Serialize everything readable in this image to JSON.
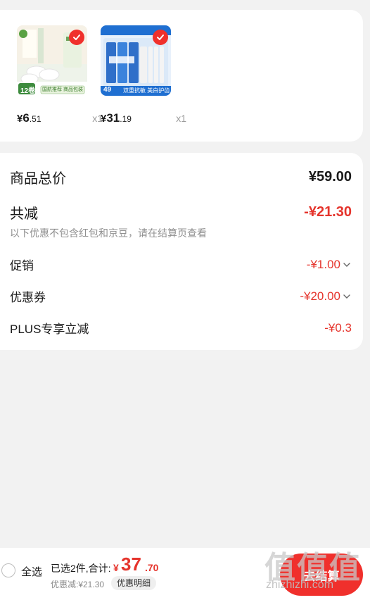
{
  "products": [
    {
      "image_text": "12卷",
      "image_banner": "国航推荐 商品包装",
      "price_symbol": "¥",
      "price_int": "6",
      "price_dec": ".51",
      "quantity": "x1"
    },
    {
      "image_text": "49",
      "image_banner": "双重抗敏 美白护齿",
      "price_symbol": "¥",
      "price_int": "31",
      "price_dec": ".19",
      "quantity": "x1"
    }
  ],
  "summary": {
    "total_label": "商品总价",
    "total_value": "¥59.00",
    "reduce_label": "共减",
    "reduce_value": "-¥21.30",
    "note": "以下优惠不包含红包和京豆，请在结算页查看",
    "promo_label": "促销",
    "promo_value": "-¥1.00",
    "coupon_label": "优惠券",
    "coupon_value": "-¥20.00",
    "plus_label": "PLUS专享立减",
    "plus_value": "-¥0.3"
  },
  "bottom": {
    "select_all": "全选",
    "selected_text": "已选2件,合计:",
    "total_yen": "¥",
    "total_int": "37",
    "total_dec": ".70",
    "discount_text": "优惠减:¥21.30",
    "detail_button": "优惠明细",
    "checkout_button": "去结算"
  },
  "watermark": {
    "chars": "值值值",
    "url": "zhizhizhi.com"
  },
  "colors": {
    "accent": "#f0302c",
    "discount_red": "#e5342c",
    "background": "#f2f2f2"
  }
}
